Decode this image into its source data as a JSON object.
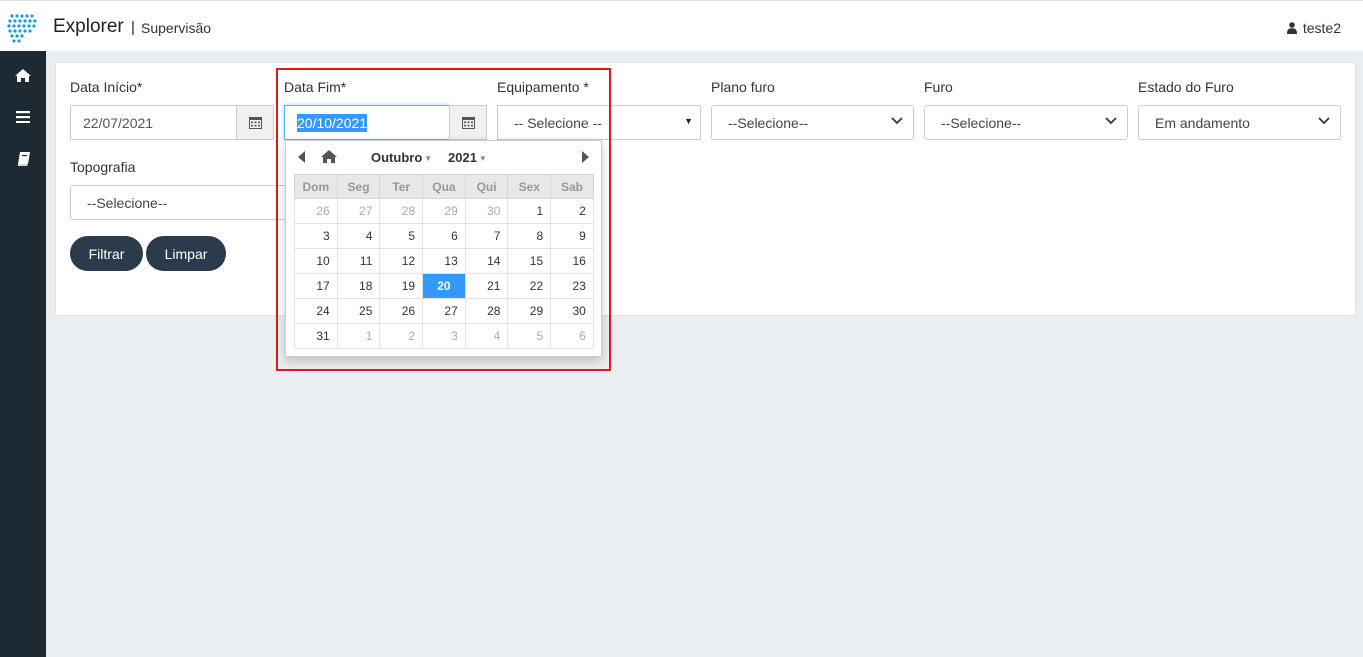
{
  "header": {
    "app_title": "Explorer",
    "separator": "|",
    "subtitle": "Supervisão",
    "user_name": "teste2"
  },
  "sidebar": {
    "items": [
      {
        "icon": "home-icon"
      },
      {
        "icon": "menu-icon"
      },
      {
        "icon": "book-icon"
      }
    ]
  },
  "filters": {
    "data_inicio": {
      "label": "Data Início*",
      "value": "22/07/2021"
    },
    "data_fim": {
      "label": "Data Fim*",
      "value": "20/10/2021"
    },
    "equipamento": {
      "label": "Equipamento *",
      "value": "-- Selecione --"
    },
    "plano_furo": {
      "label": "Plano furo",
      "value": "--Selecione--"
    },
    "furo": {
      "label": "Furo",
      "value": "--Selecione--"
    },
    "estado_furo": {
      "label": "Estado do Furo",
      "value": "Em andamento"
    },
    "topografia": {
      "label": "Topografia",
      "value": "--Selecione--"
    }
  },
  "buttons": {
    "filtrar": "Filtrar",
    "limpar": "Limpar"
  },
  "datepicker": {
    "month": "Outubro",
    "year": "2021",
    "weekdays": [
      "Dom",
      "Seg",
      "Ter",
      "Qua",
      "Qui",
      "Sex",
      "Sab"
    ],
    "weeks": [
      [
        "26",
        "27",
        "28",
        "29",
        "30",
        "1",
        "2"
      ],
      [
        "3",
        "4",
        "5",
        "6",
        "7",
        "8",
        "9"
      ],
      [
        "10",
        "11",
        "12",
        "13",
        "14",
        "15",
        "16"
      ],
      [
        "17",
        "18",
        "19",
        "20",
        "21",
        "22",
        "23"
      ],
      [
        "24",
        "25",
        "26",
        "27",
        "28",
        "29",
        "30"
      ],
      [
        "31",
        "1",
        "2",
        "3",
        "4",
        "5",
        "6"
      ]
    ],
    "selected_day": "20",
    "colors": {
      "selected": "#3399ff",
      "highlight_border": "#e3171d"
    }
  }
}
